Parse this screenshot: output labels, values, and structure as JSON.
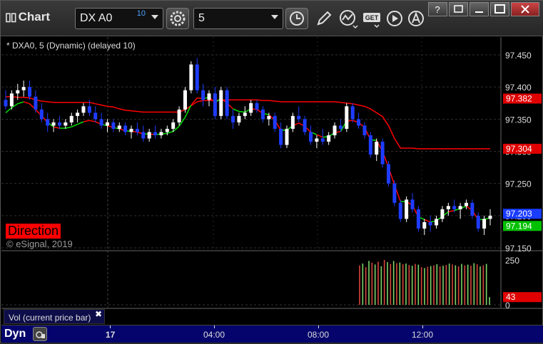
{
  "toolbar": {
    "window_title": "Chart",
    "symbol_value": "DX A0",
    "symbol_badge": "10",
    "interval_value": "5"
  },
  "chart_header": {
    "label": "* DXA0, 5 (Dynamic) (delayed 10)"
  },
  "overlay": {
    "direction_label": "Direction",
    "copyright": "© eSignal, 2019"
  },
  "study_tab": {
    "label": "Vol (current price bar)",
    "close_glyph": "✖"
  },
  "bottom_bar": {
    "mode_label": "Dyn"
  },
  "colors": {
    "up_candle": "#ffffff",
    "down_candle": "#1e3cff",
    "upper_band": "#ff0000",
    "lower_band_up": "#00e000",
    "vol_up": "#7bd66b",
    "vol_down": "#d9453d",
    "price_flag_red": "#e00000",
    "price_flag_green": "#00c000",
    "last_flag_blue": "#1a3cff"
  },
  "chart_data": {
    "type": "candlestick",
    "price_axis": {
      "ticks": [
        "97.450",
        "97.400",
        "97.350",
        "97.300",
        "97.250",
        "97.200",
        "97.150"
      ],
      "range": [
        97.15,
        97.45
      ]
    },
    "price_flags": [
      {
        "value": "97.382",
        "color": "red"
      },
      {
        "value": "97.304",
        "color": "red"
      },
      {
        "value": "97.203",
        "color": "blue"
      },
      {
        "value": "97.194",
        "color": "green"
      }
    ],
    "volume_axis": {
      "ticks": [
        "250",
        "0"
      ],
      "current_value": "43"
    },
    "time_axis": {
      "labels": [
        {
          "text": "17",
          "bold": true
        },
        {
          "text": "04:00",
          "bold": false
        },
        {
          "text": "08:00",
          "bold": false
        },
        {
          "text": "12:00",
          "bold": false
        }
      ]
    },
    "candles": [
      [
        97.38,
        97.395,
        97.365,
        97.37
      ],
      [
        97.37,
        97.395,
        97.365,
        97.39
      ],
      [
        97.39,
        97.405,
        97.38,
        97.395
      ],
      [
        97.395,
        97.41,
        97.385,
        97.4
      ],
      [
        97.4,
        97.41,
        97.38,
        97.385
      ],
      [
        97.385,
        97.395,
        97.36,
        97.365
      ],
      [
        97.365,
        97.375,
        97.345,
        97.35
      ],
      [
        97.35,
        97.36,
        97.33,
        97.34
      ],
      [
        97.34,
        97.35,
        97.33,
        97.345
      ],
      [
        97.345,
        97.355,
        97.335,
        97.34
      ],
      [
        97.34,
        97.35,
        97.335,
        97.345
      ],
      [
        97.345,
        97.36,
        97.34,
        97.355
      ],
      [
        97.355,
        97.365,
        97.345,
        97.36
      ],
      [
        97.36,
        97.375,
        97.355,
        97.37
      ],
      [
        97.37,
        97.38,
        97.355,
        97.36
      ],
      [
        97.36,
        97.37,
        97.345,
        97.35
      ],
      [
        97.35,
        97.36,
        97.335,
        97.34
      ],
      [
        97.34,
        97.35,
        97.33,
        97.345
      ],
      [
        97.345,
        97.35,
        97.33,
        97.335
      ],
      [
        97.335,
        97.345,
        97.33,
        97.34
      ],
      [
        97.34,
        97.345,
        97.325,
        97.33
      ],
      [
        97.33,
        97.34,
        97.32,
        97.335
      ],
      [
        97.335,
        97.345,
        97.325,
        97.33
      ],
      [
        97.33,
        97.34,
        97.315,
        97.32
      ],
      [
        97.32,
        97.335,
        97.315,
        97.33
      ],
      [
        97.33,
        97.34,
        97.32,
        97.325
      ],
      [
        97.325,
        97.335,
        97.32,
        97.33
      ],
      [
        97.33,
        97.34,
        97.325,
        97.335
      ],
      [
        97.335,
        97.35,
        97.33,
        97.345
      ],
      [
        97.345,
        97.37,
        97.34,
        97.365
      ],
      [
        97.365,
        97.4,
        97.36,
        97.395
      ],
      [
        97.395,
        97.44,
        97.39,
        97.435
      ],
      [
        97.435,
        97.445,
        97.39,
        97.395
      ],
      [
        97.395,
        97.405,
        97.37,
        97.38
      ],
      [
        97.38,
        97.395,
        97.37,
        97.39
      ],
      [
        97.39,
        97.4,
        97.35,
        97.355
      ],
      [
        97.355,
        97.4,
        97.35,
        97.395
      ],
      [
        97.395,
        97.4,
        97.35,
        97.355
      ],
      [
        97.355,
        97.365,
        97.335,
        97.345
      ],
      [
        97.345,
        97.36,
        97.34,
        97.355
      ],
      [
        97.355,
        97.37,
        97.35,
        97.36
      ],
      [
        97.36,
        97.38,
        97.355,
        97.375
      ],
      [
        97.375,
        97.38,
        97.36,
        97.365
      ],
      [
        97.365,
        97.37,
        97.345,
        97.35
      ],
      [
        97.35,
        97.36,
        97.34,
        97.355
      ],
      [
        97.355,
        97.36,
        97.33,
        97.335
      ],
      [
        97.335,
        97.345,
        97.305,
        97.31
      ],
      [
        97.31,
        97.34,
        97.305,
        97.335
      ],
      [
        97.335,
        97.36,
        97.33,
        97.355
      ],
      [
        97.355,
        97.37,
        97.345,
        97.35
      ],
      [
        97.35,
        97.355,
        97.325,
        97.33
      ],
      [
        97.33,
        97.34,
        97.31,
        97.315
      ],
      [
        97.315,
        97.325,
        97.305,
        97.32
      ],
      [
        97.32,
        97.335,
        97.31,
        97.315
      ],
      [
        97.315,
        97.33,
        97.31,
        97.325
      ],
      [
        97.325,
        97.345,
        97.32,
        97.34
      ],
      [
        97.34,
        97.35,
        97.33,
        97.335
      ],
      [
        97.335,
        97.375,
        97.33,
        97.37
      ],
      [
        97.37,
        97.375,
        97.345,
        97.35
      ],
      [
        97.35,
        97.36,
        97.335,
        97.34
      ],
      [
        97.34,
        97.345,
        97.32,
        97.325
      ],
      [
        97.325,
        97.33,
        97.29,
        97.295
      ],
      [
        97.295,
        97.32,
        97.285,
        97.315
      ],
      [
        97.315,
        97.32,
        97.275,
        97.28
      ],
      [
        97.28,
        97.285,
        97.245,
        97.25
      ],
      [
        97.25,
        97.255,
        97.215,
        97.22
      ],
      [
        97.22,
        97.225,
        97.19,
        97.195
      ],
      [
        97.195,
        97.23,
        97.19,
        97.225
      ],
      [
        97.225,
        97.235,
        97.205,
        97.21
      ],
      [
        97.21,
        97.215,
        97.175,
        97.18
      ],
      [
        97.18,
        97.195,
        97.17,
        97.19
      ],
      [
        97.19,
        97.2,
        97.175,
        97.185
      ],
      [
        97.185,
        97.2,
        97.18,
        97.195
      ],
      [
        97.195,
        97.215,
        97.19,
        97.21
      ],
      [
        97.21,
        97.22,
        97.2,
        97.215
      ],
      [
        97.215,
        97.225,
        97.205,
        97.21
      ],
      [
        97.21,
        97.22,
        97.195,
        97.215
      ],
      [
        97.215,
        97.225,
        97.21,
        97.22
      ],
      [
        97.22,
        97.225,
        97.195,
        97.2
      ],
      [
        97.2,
        97.205,
        97.175,
        97.18
      ],
      [
        97.18,
        97.2,
        97.17,
        97.195
      ],
      [
        97.195,
        97.21,
        97.185,
        97.2
      ]
    ],
    "upper_band": [
      97.385,
      97.385,
      97.384,
      97.384,
      97.383,
      97.38,
      97.378,
      97.377,
      97.376,
      97.376,
      97.376,
      97.376,
      97.376,
      97.376,
      97.376,
      97.374,
      97.372,
      97.37,
      97.369,
      97.366,
      97.364,
      97.363,
      97.362,
      97.361,
      97.361,
      97.361,
      97.361,
      97.361,
      97.361,
      97.361,
      97.365,
      97.371,
      97.377,
      97.379,
      97.379,
      97.379,
      97.38,
      97.38,
      97.38,
      97.38,
      97.38,
      97.38,
      97.38,
      97.379,
      97.379,
      97.378,
      97.377,
      97.377,
      97.377,
      97.377,
      97.377,
      97.377,
      97.377,
      97.377,
      97.377,
      97.377,
      97.376,
      97.375,
      97.374,
      97.372,
      97.37,
      97.366,
      97.36,
      97.354,
      97.34,
      97.32,
      97.305,
      97.305,
      97.305,
      97.304,
      97.304,
      97.304,
      97.304,
      97.304,
      97.304,
      97.304,
      97.304,
      97.304,
      97.304,
      97.304,
      97.304,
      97.304
    ],
    "lower_band": [
      97.36,
      97.368,
      97.374,
      97.377,
      97.374,
      97.365,
      97.355,
      97.345,
      97.338,
      97.336,
      97.336,
      97.338,
      97.342,
      97.346,
      97.348,
      97.346,
      97.342,
      97.34,
      97.337,
      97.335,
      97.332,
      97.331,
      97.33,
      97.327,
      97.327,
      97.326,
      97.327,
      97.328,
      97.331,
      97.339,
      97.353,
      97.372,
      97.383,
      97.382,
      97.384,
      97.376,
      97.382,
      97.375,
      97.366,
      97.362,
      97.361,
      97.366,
      97.365,
      97.359,
      97.357,
      97.348,
      97.333,
      97.333,
      97.34,
      97.344,
      97.339,
      97.33,
      97.326,
      97.322,
      97.323,
      97.329,
      97.331,
      97.347,
      97.348,
      97.345,
      97.337,
      97.318,
      97.317,
      97.3,
      97.275,
      97.248,
      97.222,
      97.222,
      97.216,
      97.198,
      97.194,
      97.19,
      97.192,
      97.199,
      97.206,
      97.208,
      97.211,
      97.215,
      97.208,
      97.194,
      97.194,
      97.197
    ],
    "volume": [
      [
        220,
        "down"
      ],
      [
        230,
        "up"
      ],
      [
        210,
        "down"
      ],
      [
        245,
        "up"
      ],
      [
        235,
        "down"
      ],
      [
        225,
        "up"
      ],
      [
        240,
        "down"
      ],
      [
        215,
        "up"
      ],
      [
        250,
        "down"
      ],
      [
        238,
        "up"
      ],
      [
        228,
        "down"
      ],
      [
        244,
        "up"
      ],
      [
        232,
        "down"
      ],
      [
        236,
        "up"
      ],
      [
        226,
        "down"
      ],
      [
        230,
        "up"
      ],
      [
        222,
        "down"
      ],
      [
        218,
        "up"
      ],
      [
        228,
        "down"
      ],
      [
        224,
        "up"
      ],
      [
        210,
        "down"
      ],
      [
        205,
        "up"
      ],
      [
        212,
        "down"
      ],
      [
        216,
        "up"
      ],
      [
        220,
        "down"
      ],
      [
        226,
        "up"
      ],
      [
        214,
        "down"
      ],
      [
        218,
        "up"
      ],
      [
        222,
        "down"
      ],
      [
        230,
        "up"
      ],
      [
        225,
        "down"
      ],
      [
        220,
        "up"
      ],
      [
        215,
        "down"
      ],
      [
        228,
        "up"
      ],
      [
        220,
        "down"
      ],
      [
        224,
        "up"
      ],
      [
        218,
        "down"
      ],
      [
        232,
        "up"
      ],
      [
        226,
        "down"
      ],
      [
        214,
        "up"
      ],
      [
        220,
        "down"
      ],
      [
        228,
        "up"
      ],
      [
        43,
        "up"
      ]
    ]
  }
}
